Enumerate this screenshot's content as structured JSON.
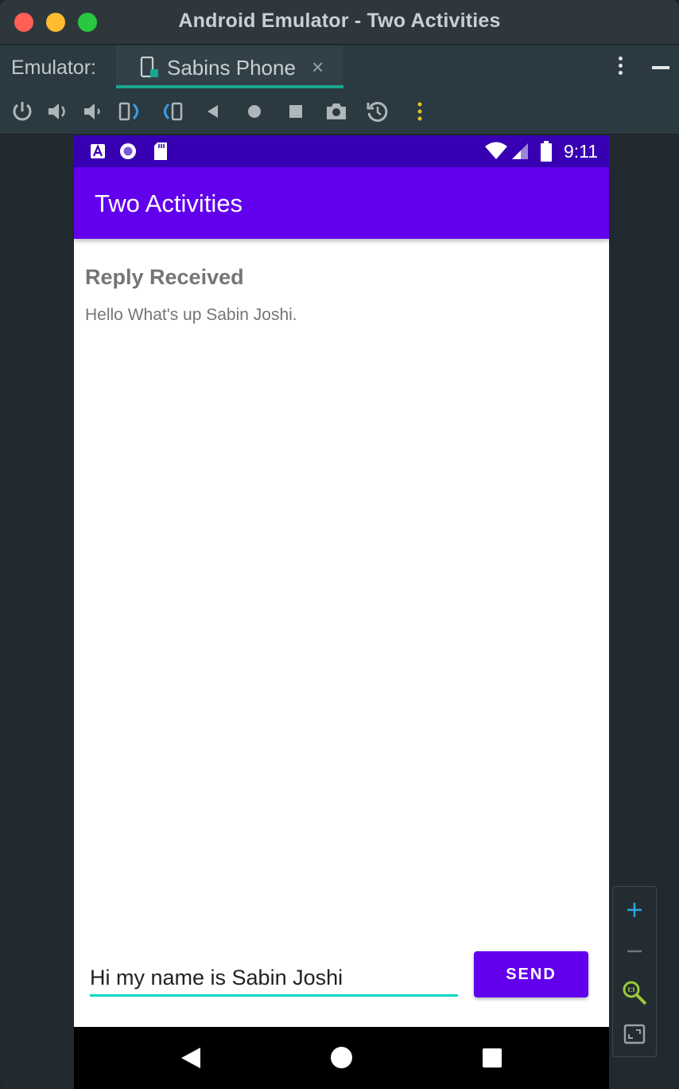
{
  "window": {
    "title": "Android Emulator - Two Activities"
  },
  "tabbar": {
    "label": "Emulator:",
    "tab_name": "Sabins Phone",
    "tab_close": "×"
  },
  "toolbar": {
    "icons": [
      "power-icon",
      "volume-up-icon",
      "volume-down-icon",
      "rotate-left-icon",
      "rotate-right-icon",
      "back-icon",
      "home-icon",
      "overview-icon",
      "screenshot-icon",
      "snapshot-icon",
      "more-icon"
    ]
  },
  "device": {
    "status_time": "9:11",
    "app_title": "Two Activities",
    "reply_heading": "Reply Received",
    "reply_text": "Hello What's up Sabin Joshi.",
    "message_input_value": "Hi my name is Sabin Joshi",
    "send_label": "SEND"
  },
  "colors": {
    "status_bar": "#3700b3",
    "app_bar": "#6200ee",
    "accent": "#03dac5",
    "tab_underline": "#1aa58f"
  },
  "zoom_panel": {
    "icons": [
      "zoom-in-icon",
      "zoom-out-icon",
      "zoom-1to1-icon",
      "fit-screen-icon"
    ]
  }
}
